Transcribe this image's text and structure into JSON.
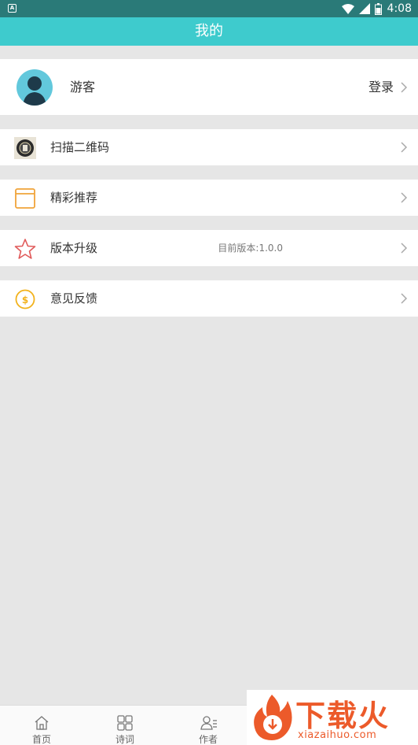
{
  "status_bar": {
    "time": "4:08"
  },
  "header": {
    "title": "我的"
  },
  "profile": {
    "name": "游客",
    "login_label": "登录"
  },
  "menu": {
    "items": [
      {
        "label": "扫描二维码",
        "icon": "qr-scan-icon"
      },
      {
        "label": "精彩推荐",
        "icon": "window-icon"
      },
      {
        "label": "版本升级",
        "icon": "star-icon",
        "detail": "目前版本:1.0.0"
      },
      {
        "label": "意见反馈",
        "icon": "coin-icon"
      }
    ]
  },
  "tab_bar": {
    "tabs": [
      {
        "label": "首页",
        "icon": "home-icon"
      },
      {
        "label": "诗词",
        "icon": "grid-icon"
      },
      {
        "label": "作者",
        "icon": "author-icon"
      }
    ]
  },
  "watermark": {
    "name": "下载火",
    "url": "xiazaihuo.com"
  },
  "colors": {
    "header": "#3ecbcd",
    "status_bar": "#2a7a78",
    "background": "#e6e6e6",
    "watermark": "#ec5a2a"
  }
}
